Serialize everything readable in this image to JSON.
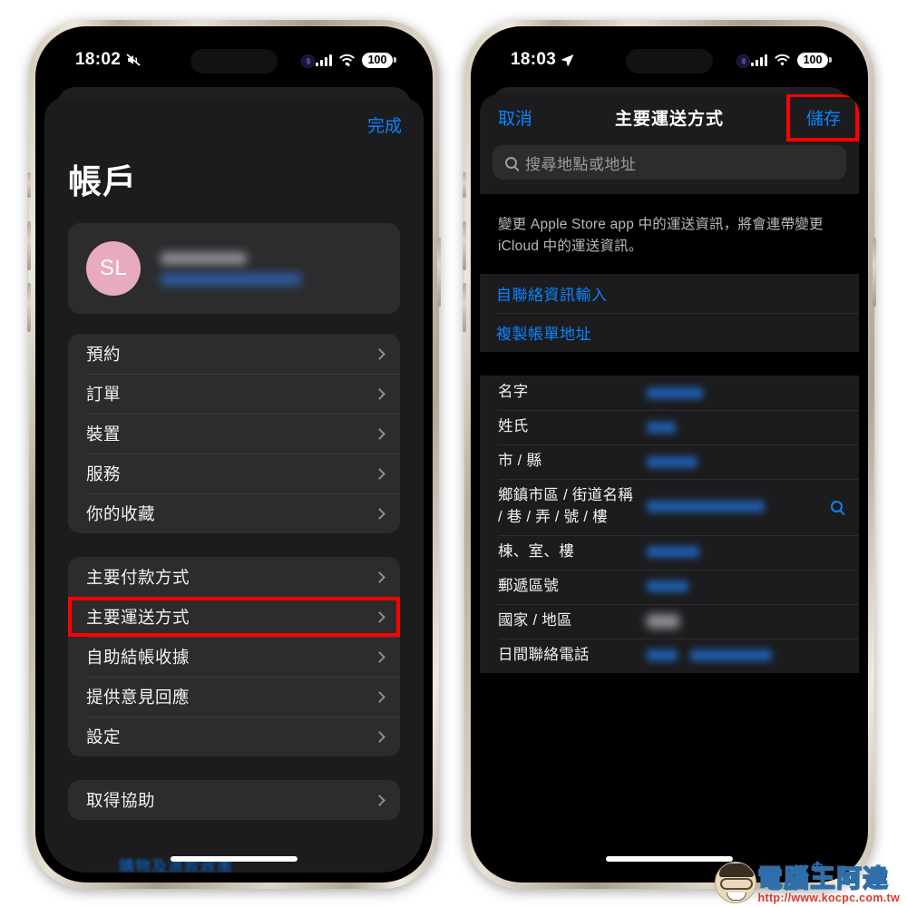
{
  "left_phone": {
    "status_bar": {
      "time": "18:02",
      "icons": [
        "mute-icon",
        "signal-bars-icon",
        "wifi-icon"
      ],
      "battery": "100"
    },
    "sheet": {
      "done_label": "完成",
      "title": "帳戶",
      "profile": {
        "avatar_initials": "SL",
        "avatar_color": "#e7aabe",
        "name_redacted": true,
        "email_redacted": true
      },
      "group1": [
        {
          "label": "預約"
        },
        {
          "label": "訂單"
        },
        {
          "label": "裝置"
        },
        {
          "label": "服務"
        },
        {
          "label": "你的收藏"
        }
      ],
      "group2": [
        {
          "label": "主要付款方式",
          "highlighted": false
        },
        {
          "label": "主要運送方式",
          "highlighted": true
        },
        {
          "label": "自助結帳收據",
          "highlighted": false
        },
        {
          "label": "提供意見回應",
          "highlighted": false
        },
        {
          "label": "設定",
          "highlighted": false
        }
      ],
      "group3": [
        {
          "label": "取得協助"
        }
      ],
      "bottom_cut_text": "購物及退款政策"
    }
  },
  "right_phone": {
    "status_bar": {
      "time": "18:03",
      "icons": [
        "location-arrow-icon",
        "signal-bars-icon",
        "wifi-icon"
      ],
      "battery": "100"
    },
    "nav": {
      "cancel_label": "取消",
      "title": "主要運送方式",
      "save_label": "儲存",
      "save_highlighted": true
    },
    "search": {
      "placeholder": "搜尋地點或地址",
      "value": ""
    },
    "description": "變更 Apple Store app 中的運送資訊，將會連帶變更 iCloud 中的運送資訊。",
    "actions": [
      {
        "label": "自聯絡資訊輸入"
      },
      {
        "label": "複製帳單地址"
      }
    ],
    "form_fields": [
      {
        "label": "名字",
        "value_redacted": true,
        "redaction": "blue",
        "width": "w1",
        "has_search": false
      },
      {
        "label": "姓氏",
        "value_redacted": true,
        "redaction": "blue",
        "width": "w2",
        "has_search": false
      },
      {
        "label": "市 / 縣",
        "value_redacted": true,
        "redaction": "blue",
        "width": "w3",
        "has_search": false
      },
      {
        "label": "鄉鎮市區 / 街道名稱 / 巷 / 弄 / 號 / 樓",
        "value_redacted": true,
        "redaction": "blue",
        "width": "w4",
        "has_search": true
      },
      {
        "label": "棟、室、樓",
        "value_redacted": true,
        "redaction": "blue",
        "width": "w5",
        "has_search": false
      },
      {
        "label": "郵遞區號",
        "value_redacted": true,
        "redaction": "blue",
        "width": "w6",
        "has_search": false
      },
      {
        "label": "國家 / 地區",
        "value_redacted": true,
        "redaction": "grey",
        "width": "grey",
        "has_search": false
      },
      {
        "label": "日間聯絡電話",
        "value_redacted": true,
        "redaction": "blue-split",
        "width": "w7",
        "has_search": false
      }
    ]
  },
  "watermark": {
    "site_name": "電腦王阿達",
    "url": "http://www.kocpc.com.tw",
    "crown": "♔"
  },
  "colors": {
    "accent_blue": "#0a84ff",
    "highlight_red": "#ff0000",
    "sheet_bg": "#1c1c1e",
    "card_bg": "#2c2c2e",
    "avatar_pink": "#e7aabe"
  }
}
